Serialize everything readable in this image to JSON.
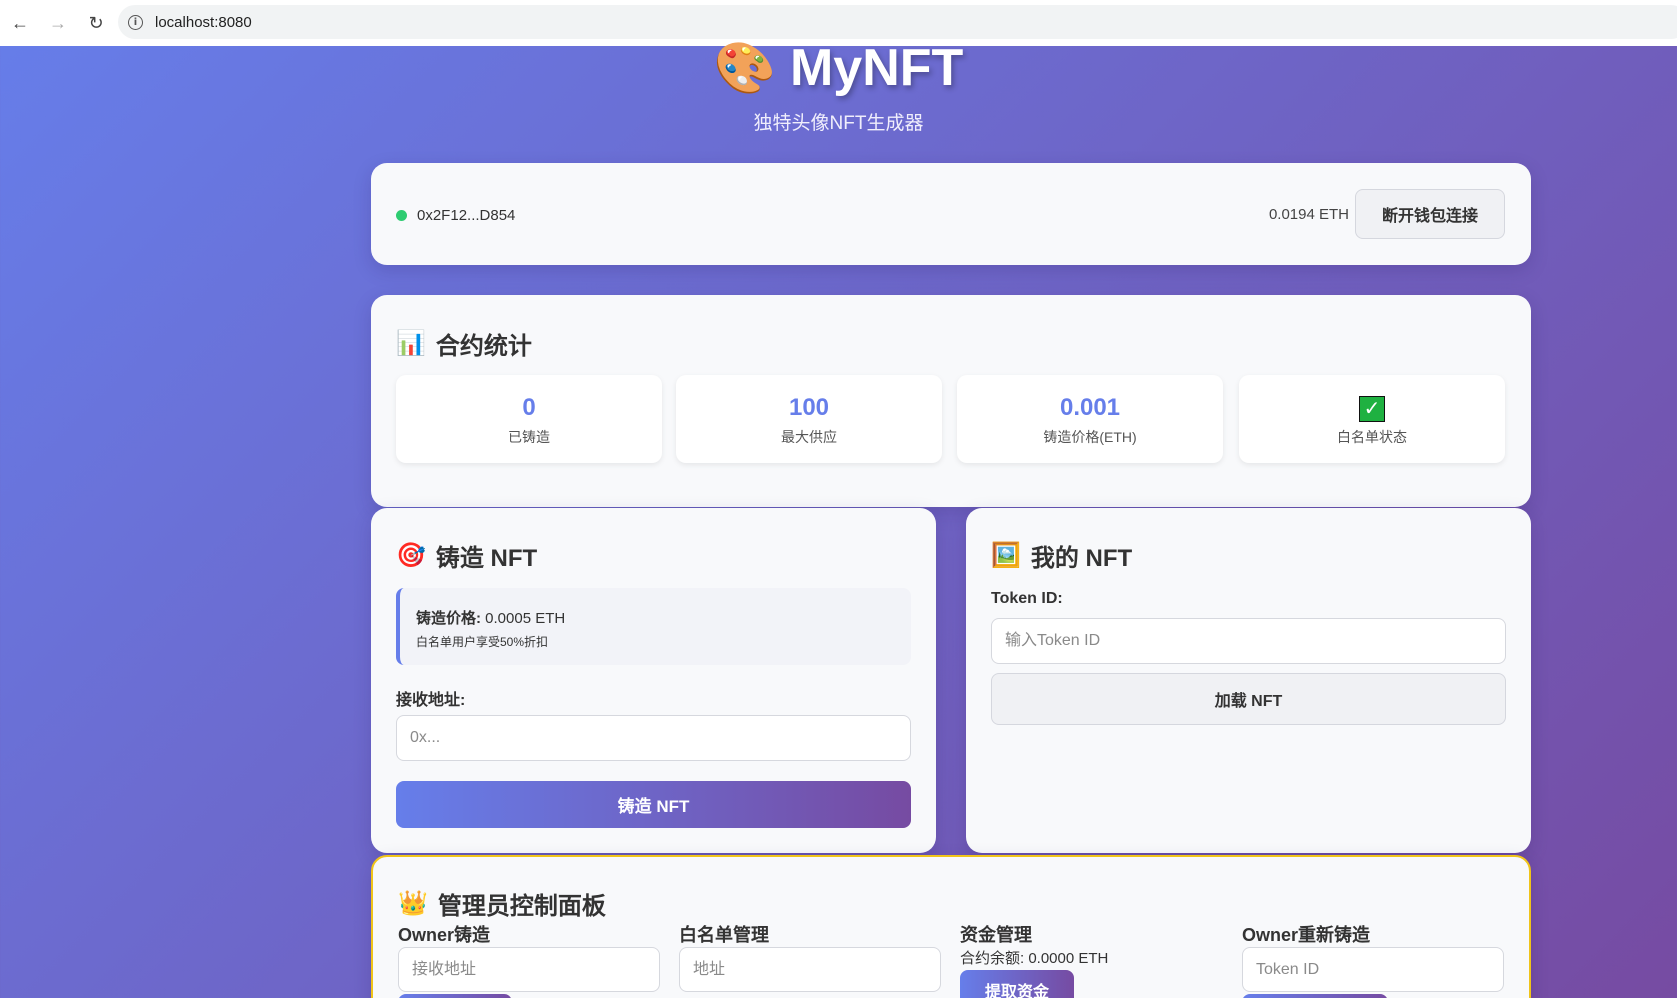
{
  "browser": {
    "url": "localhost:8080",
    "back_icon": "←",
    "forward_icon": "→",
    "reload_icon": "↻",
    "info_icon": "i"
  },
  "header": {
    "icon": "🎨",
    "title": "MyNFT",
    "subtitle": "独特头像NFT生成器"
  },
  "wallet": {
    "address": "0x2F12...D854",
    "balance": "0.0194 ETH",
    "disconnect_label": "断开钱包连接",
    "status_color": "#2ecc71"
  },
  "stats": {
    "icon": "📊",
    "title": "合约统计",
    "items": [
      {
        "value": "0",
        "label": "已铸造"
      },
      {
        "value": "100",
        "label": "最大供应"
      },
      {
        "value": "0.001",
        "label": "铸造价格(ETH)"
      },
      {
        "value": "✓",
        "label": "白名单状态"
      }
    ]
  },
  "mint": {
    "icon": "🎯",
    "title": "铸造 NFT",
    "price_label": "铸造价格:",
    "price_value": "0.0005 ETH",
    "price_note": "白名单用户享受50%折扣",
    "receiver_label": "接收地址:",
    "receiver_placeholder": "0x...",
    "mint_button": "铸造 NFT"
  },
  "my_nft": {
    "icon": "🖼️",
    "title": "我的 NFT",
    "token_label": "Token ID:",
    "token_placeholder": "输入Token ID",
    "load_button": "加载 NFT"
  },
  "admin": {
    "icon": "👑",
    "title": "管理员控制面板",
    "owner_mint_title": "Owner铸造",
    "owner_mint_placeholder": "接收地址",
    "whitelist_title": "白名单管理",
    "whitelist_placeholder": "地址",
    "funds_title": "资金管理",
    "funds_balance": "合约余额: 0.0000 ETH",
    "withdraw_button": "提取资金",
    "remint_title": "Owner重新铸造",
    "remint_placeholder": "Token ID"
  },
  "colors": {
    "accent": "#667eea",
    "gradient_end": "#764ba2",
    "admin_border": "#f0c419"
  }
}
